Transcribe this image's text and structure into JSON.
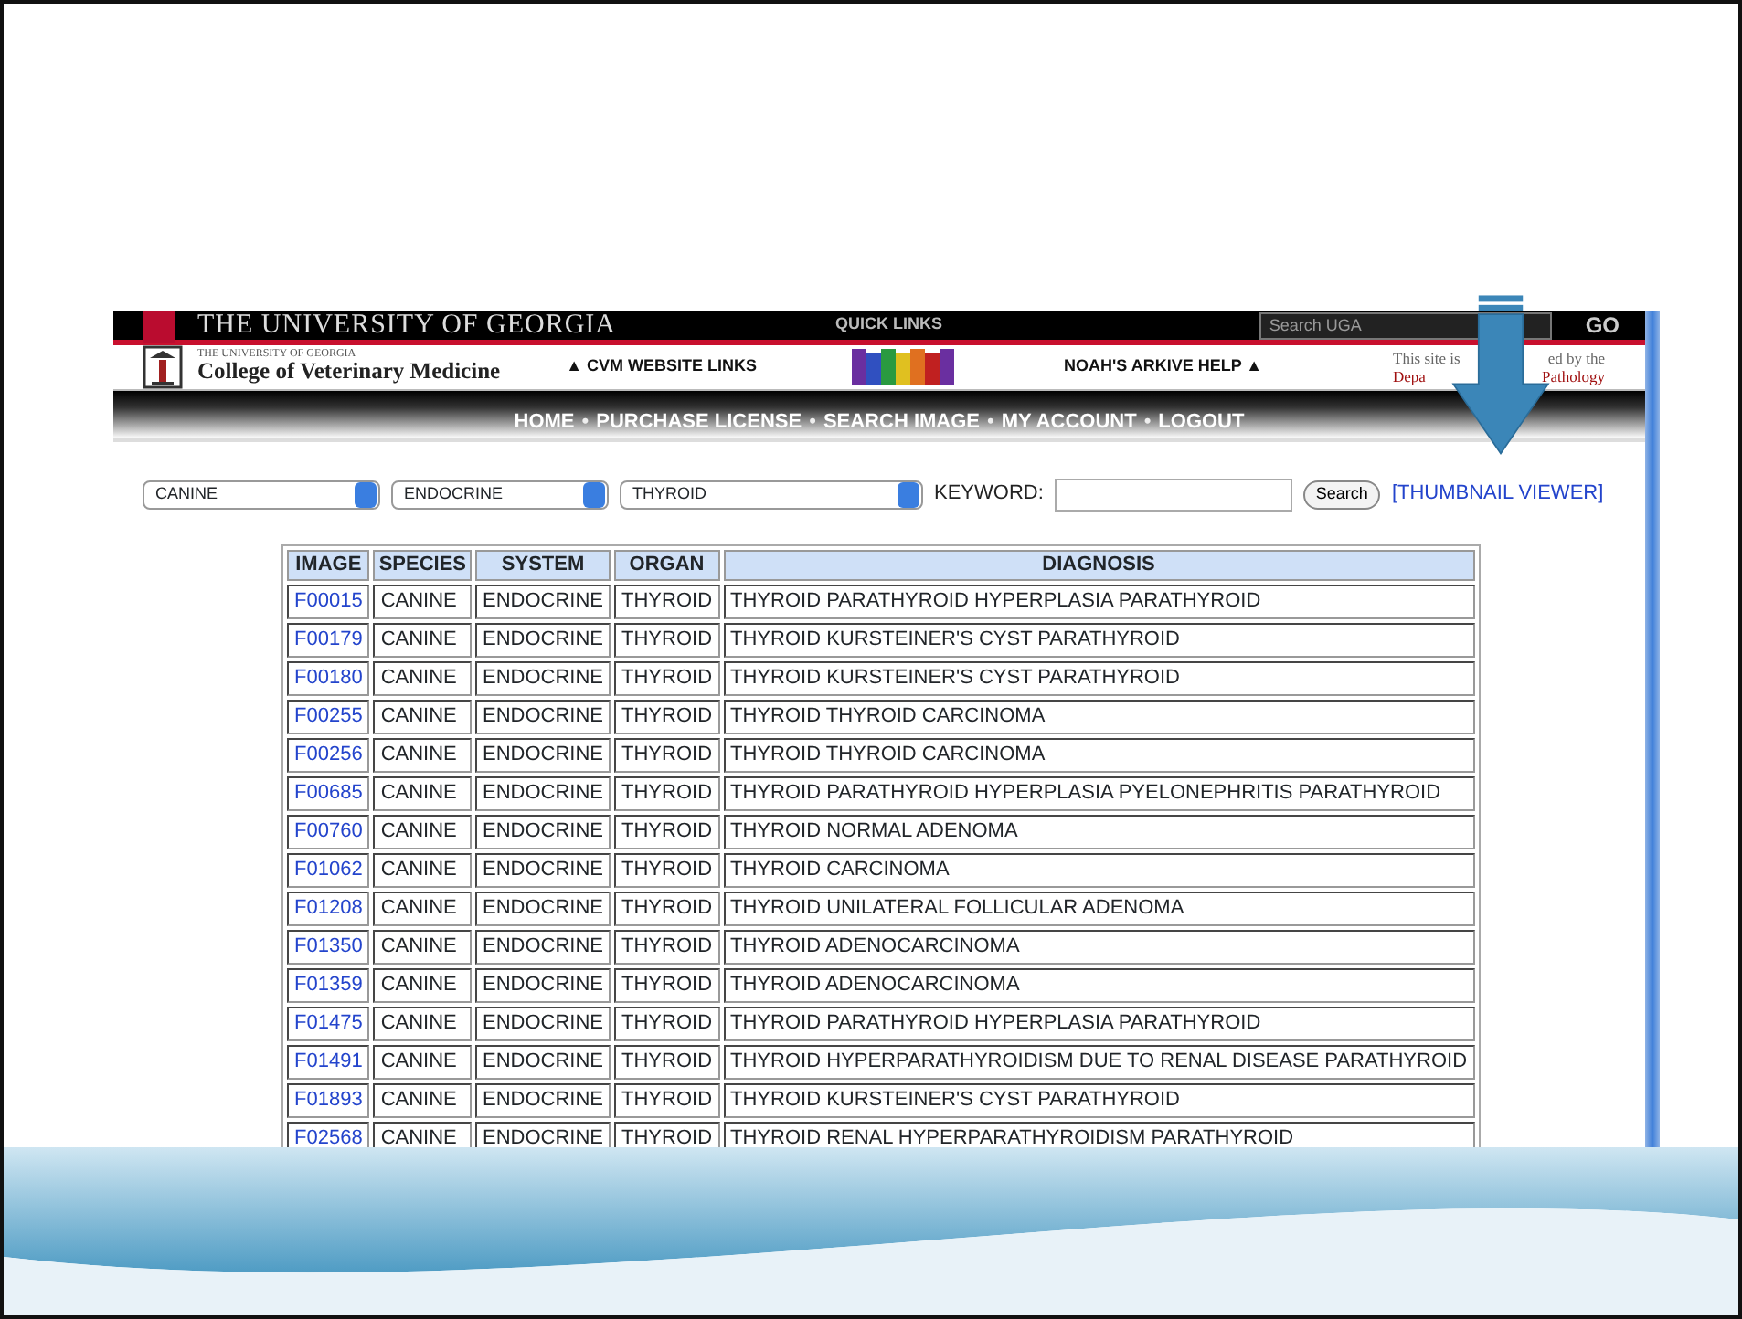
{
  "top_bar": {
    "university": "THE UNIVERSITY OF GEORGIA",
    "quick_links": "QUICK LINKS",
    "search": {
      "placeholder": "Search UGA"
    },
    "go": "GO"
  },
  "brand": {
    "overline": "THE UNIVERSITY OF GEORGIA",
    "name": "College of Veterinary Medicine"
  },
  "header_links": [
    {
      "label": "▲ CVM WEBSITE LINKS"
    },
    {
      "label": "NOAH'S ARKIVE HELP ▲"
    }
  ],
  "site_note": [
    [
      "This site is",
      "ed by the"
    ],
    [
      "Depa",
      "Pathology"
    ]
  ],
  "nav": [
    {
      "kind": "link",
      "label": "HOME"
    },
    {
      "kind": "separator",
      "label": "•"
    },
    {
      "kind": "link",
      "label": "PURCHASE LICENSE"
    },
    {
      "kind": "separator",
      "label": "•"
    },
    {
      "kind": "link",
      "label": "SEARCH IMAGE"
    },
    {
      "kind": "separator",
      "label": "•"
    },
    {
      "kind": "link",
      "label": "MY ACCOUNT"
    },
    {
      "kind": "separator",
      "label": "•"
    },
    {
      "kind": "link",
      "label": "LOGOUT"
    }
  ],
  "filters": {
    "selects": [
      "CANINE",
      "ENDOCRINE",
      "THYROID"
    ],
    "keyword_label": "KEYWORD:",
    "search_button": "Search",
    "thumbnail_link": "[THUMBNAIL VIEWER]"
  },
  "table": {
    "columns": [
      "IMAGE",
      "SPECIES",
      "SYSTEM",
      "ORGAN",
      "DIAGNOSIS"
    ],
    "rows": [
      [
        "F00015",
        "CANINE",
        "ENDOCRINE",
        "THYROID",
        "THYROID PARATHYROID HYPERPLASIA PARATHYROID"
      ],
      [
        "F00179",
        "CANINE",
        "ENDOCRINE",
        "THYROID",
        "THYROID KURSTEINER'S CYST PARATHYROID"
      ],
      [
        "F00180",
        "CANINE",
        "ENDOCRINE",
        "THYROID",
        "THYROID KURSTEINER'S CYST PARATHYROID"
      ],
      [
        "F00255",
        "CANINE",
        "ENDOCRINE",
        "THYROID",
        "THYROID THYROID CARCINOMA"
      ],
      [
        "F00256",
        "CANINE",
        "ENDOCRINE",
        "THYROID",
        "THYROID THYROID CARCINOMA"
      ],
      [
        "F00685",
        "CANINE",
        "ENDOCRINE",
        "THYROID",
        "THYROID PARATHYROID HYPERPLASIA PYELONEPHRITIS PARATHYROID"
      ],
      [
        "F00760",
        "CANINE",
        "ENDOCRINE",
        "THYROID",
        "THYROID NORMAL ADENOMA"
      ],
      [
        "F01062",
        "CANINE",
        "ENDOCRINE",
        "THYROID",
        "THYROID CARCINOMA"
      ],
      [
        "F01208",
        "CANINE",
        "ENDOCRINE",
        "THYROID",
        "THYROID UNILATERAL FOLLICULAR ADENOMA"
      ],
      [
        "F01350",
        "CANINE",
        "ENDOCRINE",
        "THYROID",
        "THYROID ADENOCARCINOMA"
      ],
      [
        "F01359",
        "CANINE",
        "ENDOCRINE",
        "THYROID",
        "THYROID ADENOCARCINOMA"
      ],
      [
        "F01475",
        "CANINE",
        "ENDOCRINE",
        "THYROID",
        "THYROID PARATHYROID HYPERPLASIA PARATHYROID"
      ],
      [
        "F01491",
        "CANINE",
        "ENDOCRINE",
        "THYROID",
        "THYROID HYPERPARATHYROIDISM DUE TO RENAL DISEASE PARATHYROID"
      ],
      [
        "F01893",
        "CANINE",
        "ENDOCRINE",
        "THYROID",
        "THYROID KURSTEINER'S CYST PARATHYROID"
      ],
      [
        "F02568",
        "CANINE",
        "ENDOCRINE",
        "THYROID",
        "THYROID RENAL HYPERPARATHYROIDISM PARATHYROID"
      ]
    ]
  }
}
